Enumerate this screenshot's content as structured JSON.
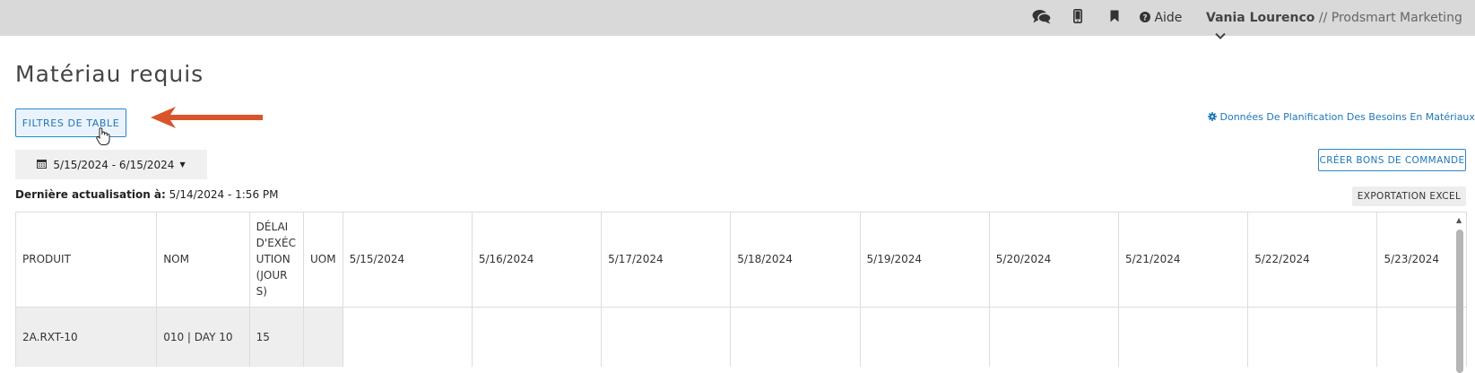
{
  "header": {
    "help_label": "Aide",
    "user_name": "Vania Lourenco",
    "separator": "//",
    "organization": "Prodsmart Marketing"
  },
  "page": {
    "title": "Matériau requis",
    "filters_button": "FILTRES DE TABLE",
    "mrp_link": "Données De Planification Des Besoins En Matériaux",
    "date_range": "5/15/2024 - 6/15/2024",
    "create_po_button": "CRÉER BONS DE COMMANDE",
    "last_update_label": "Dernière actualisation à:",
    "last_update_value": "5/14/2024 - 1:56 PM",
    "excel_button": "EXPORTATION EXCEL"
  },
  "table": {
    "columns": [
      "PRODUIT",
      "NOM",
      "DÉLAI D'EXÉCUTION (JOURS)",
      "UOM",
      "5/15/2024",
      "5/16/2024",
      "5/17/2024",
      "5/18/2024",
      "5/19/2024",
      "5/20/2024",
      "5/21/2024",
      "5/22/2024",
      "5/23/2024"
    ],
    "rows": [
      [
        "2A.RXT-10",
        "010 | DAY 10",
        "15",
        "",
        "",
        "",
        "",
        "",
        "",
        "",
        "",
        "",
        ""
      ]
    ]
  },
  "colors": {
    "accent": "#1f76b8",
    "annotation_arrow": "#d9542b",
    "topbar": "#d9d9d9"
  },
  "icons": {
    "chat": "comments-icon",
    "mobile": "mobile-phone-icon",
    "bookmark": "bookmark-icon",
    "help": "question-circle-icon",
    "calendar": "calendar-icon",
    "settings": "gear-icon"
  }
}
